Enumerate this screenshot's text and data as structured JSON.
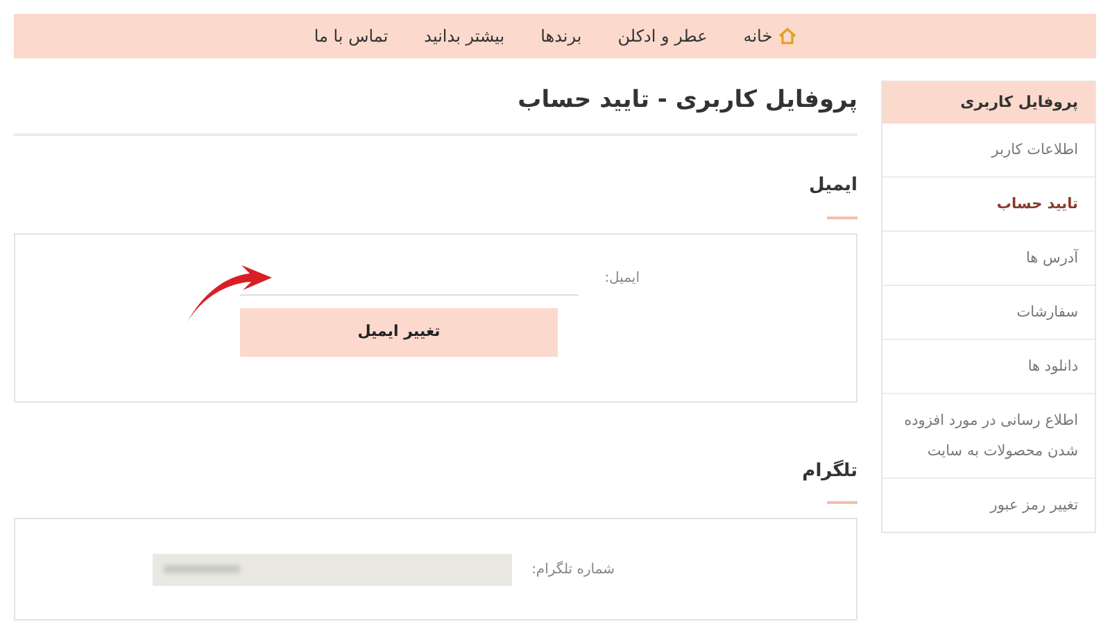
{
  "nav": {
    "items": [
      {
        "label": "خانه",
        "kind": "home"
      },
      {
        "label": "عطر و ادکلن",
        "kind": "link"
      },
      {
        "label": "برندها",
        "kind": "link"
      },
      {
        "label": "بیشتر بدانید",
        "kind": "link"
      },
      {
        "label": "تماس با ما",
        "kind": "link"
      }
    ]
  },
  "sidebar": {
    "title": "پروفایل کاربری",
    "items": [
      {
        "label": "اطلاعات کاربر",
        "selected": false
      },
      {
        "label": "تایید حساب",
        "selected": true
      },
      {
        "label": "آدرس ها",
        "selected": false
      },
      {
        "label": "سفارشات",
        "selected": false
      },
      {
        "label": "دانلود ها",
        "selected": false
      },
      {
        "label": "اطلاع رسانی در مورد افزوده شدن محصولات به سایت",
        "selected": false
      },
      {
        "label": "تغییر رمز عبور",
        "selected": false
      }
    ]
  },
  "page_title": "پروفایل کاربری - تایید حساب",
  "email_section": {
    "heading": "ایمیل",
    "field_label": "ایمیل:",
    "button": "تغییر ایمیل"
  },
  "telegram_section": {
    "heading": "تلگرام",
    "field_label": "شماره تلگرام:",
    "disabled": true
  }
}
